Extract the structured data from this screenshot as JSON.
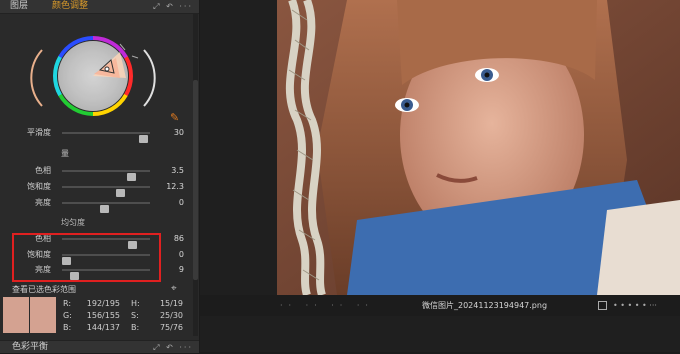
{
  "panel": {
    "header_title": "图层",
    "tab_active": "颜色调整",
    "header_icons": "⤢ ↶ ···"
  },
  "wheel": {
    "picker_icon": "eyedropper-icon"
  },
  "smoothness": {
    "label": "平滑度",
    "value": "30",
    "level": 0.92
  },
  "amount": {
    "section_title": "量",
    "rows": [
      {
        "label": "色相",
        "value": "3.5",
        "level": 0.78
      },
      {
        "label": "饱和度",
        "value": "12.3",
        "level": 0.66
      },
      {
        "label": "亮度",
        "value": "0",
        "level": 0.48
      }
    ]
  },
  "uniformity": {
    "section_title": "均匀度",
    "rows": [
      {
        "label": "色相",
        "value": "86",
        "level": 0.8
      },
      {
        "label": "饱和度",
        "value": "0",
        "level": 0.05
      },
      {
        "label": "亮度",
        "value": "9",
        "level": 0.14
      }
    ]
  },
  "view_range": {
    "label": "查看已选色彩范围"
  },
  "readout": {
    "R_label": "R:",
    "R_value": "192/195",
    "G_label": "G:",
    "G_value": "156/155",
    "B_label": "B:",
    "B_value": "144/137",
    "H_label": "H:",
    "H_value": "15/19",
    "S_label": "S:",
    "S_value": "25/30",
    "B2_label": "B:",
    "B2_value": "75/76"
  },
  "bottom_panel": {
    "title": "色彩平衡"
  },
  "statusbar": {
    "left_dots": "·· ·· ·· ··",
    "filename": "微信图片_20241123194947.png",
    "right_dots": "• • • • • ···"
  },
  "colors": {
    "highlight": "#e02020",
    "accent": "#e07a20",
    "swatch": "#d4a291"
  }
}
